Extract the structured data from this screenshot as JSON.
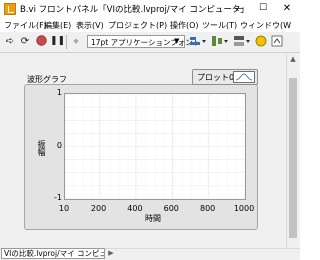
{
  "window": {
    "title": "B.vi フロントパネル「VIの比較.lvproj/マイ コンピュータ」",
    "min_symbol": "—",
    "max_symbol": "☐",
    "close_symbol": "✕"
  },
  "menu": [
    "ファイル(F)",
    "編集(E)",
    "表示(V)",
    "プロジェクト(P)",
    "操作(O)",
    "ツール(T)",
    "ウィンドウ(W"
  ],
  "toolbar": {
    "font_select": "17pt アプリケーションフォント",
    "icons": [
      "run-arrow-icon",
      "run-continuous-icon",
      "abort-icon",
      "pause-icon",
      "align-icon",
      "distribute-icon",
      "resize-icon",
      "reorder-icon",
      "help-icon"
    ]
  },
  "graph": {
    "label": "波形グラフ",
    "legend_label": "プロット0"
  },
  "chart_data": {
    "type": "line",
    "title": "波形グラフ",
    "xlabel": "時間",
    "ylabel": "振幅",
    "xlim": [
      10,
      1000
    ],
    "ylim": [
      -1,
      1
    ],
    "x_ticks": [
      "10",
      "200",
      "400",
      "600",
      "800",
      "1000"
    ],
    "y_ticks": [
      "1",
      "0.75",
      "0.5",
      "0.25",
      "0",
      "-0.25",
      "-0.5",
      "-0.75",
      "-1"
    ],
    "grid": true,
    "series": [
      {
        "name": "プロット0",
        "values": []
      }
    ]
  },
  "status": {
    "context": "VIの比較.lvproj/マイ コンピュータ"
  },
  "colors": {
    "panel_bg": "#f0f0f0",
    "graph_frame": "#e3e3e3",
    "plot_bg": "#ffffff",
    "grid": "#e6e6e6",
    "vi_icon": "#f39c12"
  }
}
